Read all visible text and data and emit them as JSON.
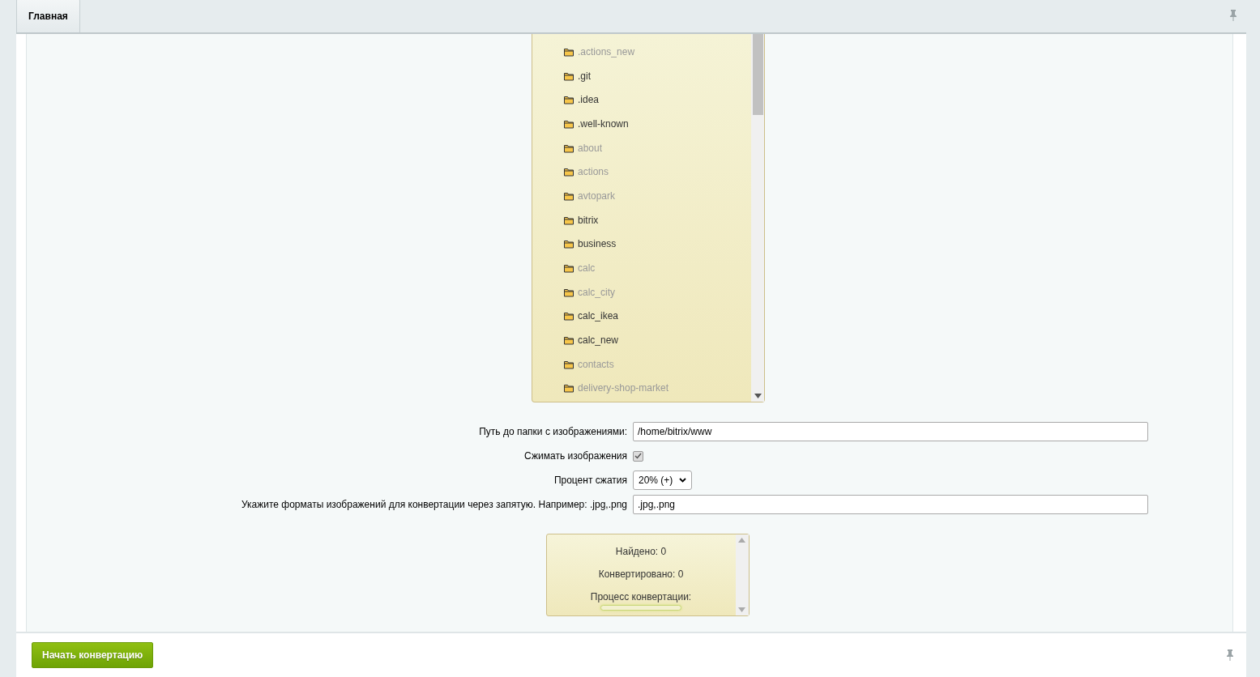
{
  "tabs": [
    {
      "label": "Главная",
      "selected": true
    }
  ],
  "folders": [
    {
      "name": ".actions_new",
      "dimmed": true
    },
    {
      "name": ".git",
      "dimmed": false
    },
    {
      "name": ".idea",
      "dimmed": false
    },
    {
      "name": ".well-known",
      "dimmed": false
    },
    {
      "name": "about",
      "dimmed": true
    },
    {
      "name": "actions",
      "dimmed": true
    },
    {
      "name": "avtopark",
      "dimmed": true
    },
    {
      "name": "bitrix",
      "dimmed": false
    },
    {
      "name": "business",
      "dimmed": false
    },
    {
      "name": "calc",
      "dimmed": true
    },
    {
      "name": "calc_city",
      "dimmed": true
    },
    {
      "name": "calc_ikea",
      "dimmed": false
    },
    {
      "name": "calc_new",
      "dimmed": false
    },
    {
      "name": "contacts",
      "dimmed": true
    },
    {
      "name": "delivery-shop-market",
      "dimmed": true
    }
  ],
  "form": [
    {
      "kind": "text",
      "label": "Путь до папки с изображениями:",
      "value": "/home/bitrix/www"
    },
    {
      "kind": "checkbox",
      "label": "Сжимать изображения",
      "checked": true
    },
    {
      "kind": "select",
      "label": "Процент сжатия",
      "value": "20% (+)"
    },
    {
      "kind": "text",
      "label": "Укажите форматы изображений для конвертации через запятую. Например: .jpg,.png",
      "value": ".jpg,.png"
    }
  ],
  "status": {
    "found": "Найдено: 0",
    "converted": "Конвертировано: 0",
    "process_label": "Процесс конвертации:",
    "level": 0
  },
  "buttons": [
    "Начать конвертацию"
  ]
}
